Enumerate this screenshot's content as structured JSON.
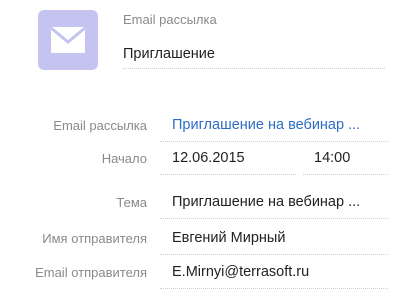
{
  "header": {
    "icon": "envelope-icon",
    "avatar_color": "#c5c4f0",
    "label": "Email рассылка",
    "value": "Приглашение"
  },
  "fields": {
    "mailing": {
      "label": "Email рассылка",
      "value": "Приглашение на вебинар ..."
    },
    "start": {
      "label": "Начало",
      "date": "12.06.2015",
      "time": "14:00"
    },
    "subject": {
      "label": "Тема",
      "value": "Приглашение на вебинар ..."
    },
    "sender_name": {
      "label": "Имя отправителя",
      "value": "Евгений Мирный"
    },
    "sender_email": {
      "label": "Email отправителя",
      "value": "E.Mirnyi@terrasoft.ru"
    }
  },
  "colors": {
    "link": "#2d6dc7",
    "label": "#8a8a8a"
  }
}
